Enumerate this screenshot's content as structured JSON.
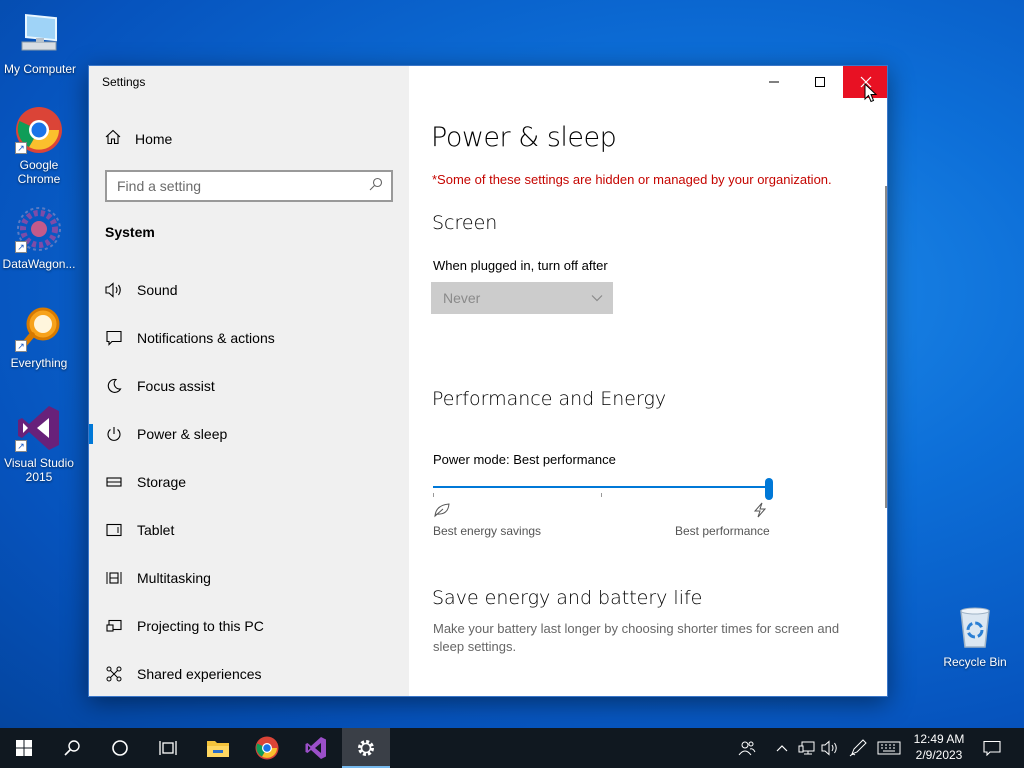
{
  "desktop": {
    "icons": [
      {
        "label": "My Computer"
      },
      {
        "label": "Google Chrome"
      },
      {
        "label": "DataWagon..."
      },
      {
        "label": "Everything"
      },
      {
        "label": "Visual Studio 2015"
      },
      {
        "label": "Recycle Bin"
      }
    ]
  },
  "window": {
    "title": "Settings",
    "controls": {
      "minimize_icon": "minimize-icon",
      "maximize_icon": "maximize-icon",
      "close_icon": "close-icon"
    }
  },
  "nav": {
    "home_label": "Home",
    "search_placeholder": "Find a setting",
    "section_title": "System",
    "items": [
      {
        "label": "Sound",
        "icon": "speaker-icon"
      },
      {
        "label": "Notifications & actions",
        "icon": "notification-icon"
      },
      {
        "label": "Focus assist",
        "icon": "moon-icon"
      },
      {
        "label": "Power & sleep",
        "icon": "power-icon",
        "selected": true
      },
      {
        "label": "Storage",
        "icon": "storage-icon"
      },
      {
        "label": "Tablet",
        "icon": "tablet-icon"
      },
      {
        "label": "Multitasking",
        "icon": "multitasking-icon"
      },
      {
        "label": "Projecting to this PC",
        "icon": "projector-icon"
      },
      {
        "label": "Shared experiences",
        "icon": "shared-experiences-icon"
      }
    ]
  },
  "content": {
    "page_title": "Power & sleep",
    "org_note": "*Some of these settings are hidden or managed by your organization.",
    "screen": {
      "heading": "Screen",
      "plugged_label": "When plugged in, turn off after",
      "plugged_value": "Never"
    },
    "performance": {
      "heading": "Performance and Energy",
      "mode_label": "Power mode: Best performance",
      "slider_level": 1.0,
      "left_label": "Best energy savings",
      "right_label": "Best performance"
    },
    "save": {
      "heading": "Save energy and battery life",
      "description": "Make your battery last longer by choosing shorter times for screen and sleep settings."
    }
  },
  "taskbar": {
    "clock_time": "12:49 AM",
    "clock_date": "2/9/2023",
    "colors": {
      "accent": "#0078d7",
      "close": "#e81123",
      "warning": "#c50500"
    }
  }
}
